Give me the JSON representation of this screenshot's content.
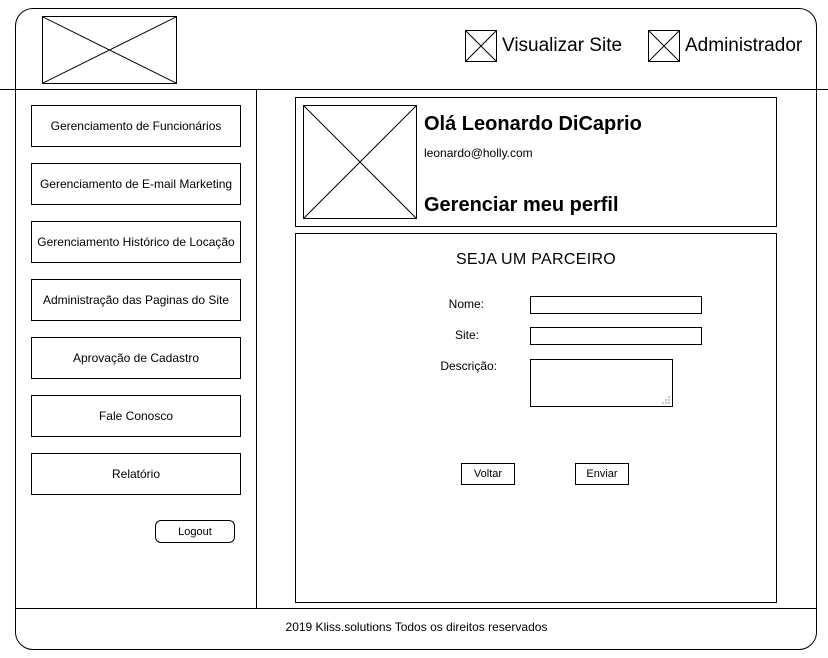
{
  "header": {
    "links": [
      {
        "label": "Visualizar Site",
        "icon": "placeholder-icon"
      },
      {
        "label": "Administrador",
        "icon": "placeholder-icon"
      }
    ]
  },
  "sidebar": {
    "items": [
      {
        "label": "Gerenciamento de Funcionários"
      },
      {
        "label": "Gerenciamento de E-mail Marketing"
      },
      {
        "label": "Gerenciamento Histórico de Locação"
      },
      {
        "label": "Administração das Paginas do Site"
      },
      {
        "label": "Aprovação de Cadastro"
      },
      {
        "label": "Fale Conosco"
      },
      {
        "label": "Relatório"
      }
    ],
    "logout_label": "Logout"
  },
  "profile": {
    "greeting": "Olá Leonardo DiCaprio",
    "email": "leonardo@holly.com",
    "manage_label": "Gerenciar meu perfil"
  },
  "partner_form": {
    "title": "SEJA UM PARCEIRO",
    "fields": {
      "name_label": "Nome:",
      "site_label": "Site:",
      "description_label": "Descrição:"
    },
    "back_label": "Voltar",
    "submit_label": "Enviar"
  },
  "footer": {
    "text": "2019 Kliss.solutions Todos os direitos reservados"
  }
}
